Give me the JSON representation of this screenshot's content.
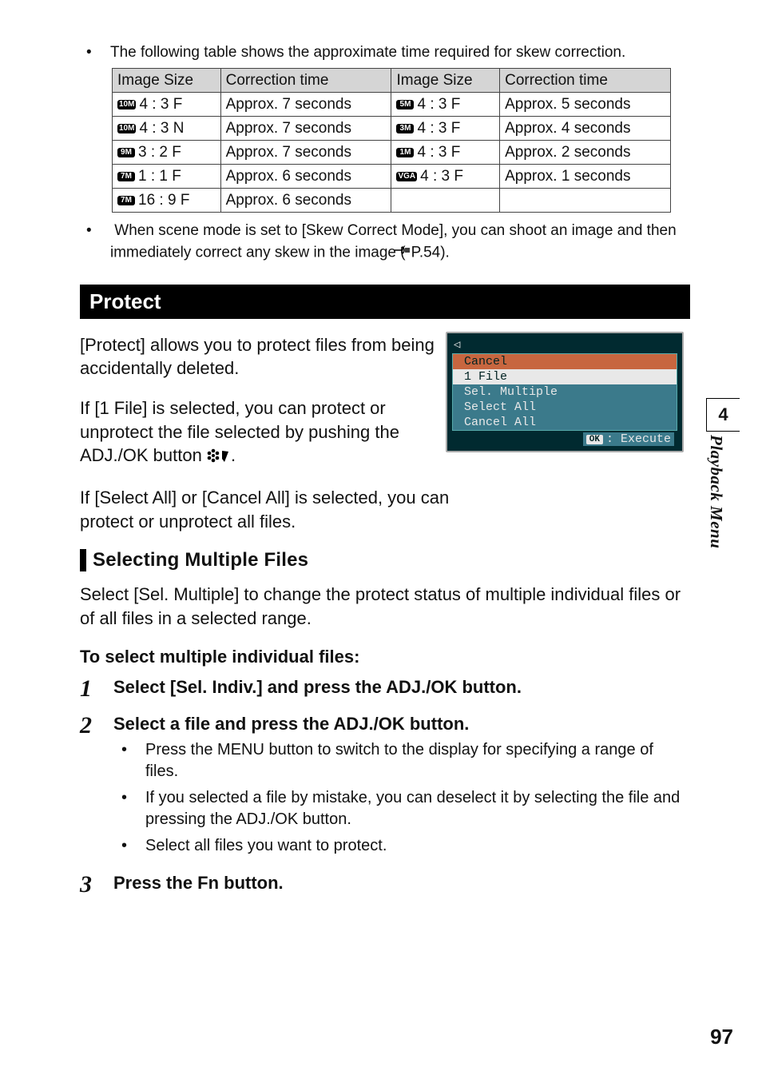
{
  "intro": "The following table shows the approximate time required for skew correction.",
  "table": {
    "headers": [
      "Image Size",
      "Correction time",
      "Image Size",
      "Correction time"
    ],
    "rows": [
      {
        "l_badge": "10M",
        "l_ratio": "4 : 3 F",
        "l_time": "Approx. 7 seconds",
        "r_badge": "5M",
        "r_ratio": "4 : 3 F",
        "r_time": "Approx. 5 seconds"
      },
      {
        "l_badge": "10M",
        "l_ratio": "4 : 3 N",
        "l_time": "Approx. 7 seconds",
        "r_badge": "3M",
        "r_ratio": "4 : 3 F",
        "r_time": "Approx. 4 seconds"
      },
      {
        "l_badge": "9M",
        "l_ratio": "3 : 2 F",
        "l_time": "Approx. 7 seconds",
        "r_badge": "1M",
        "r_ratio": "4 : 3 F",
        "r_time": "Approx. 2 seconds"
      },
      {
        "l_badge": "7M",
        "l_ratio": "1 : 1 F",
        "l_time": "Approx. 6 seconds",
        "r_badge": "VGA",
        "r_ratio": "4 : 3 F",
        "r_time": "Approx. 1 seconds"
      },
      {
        "l_badge": "7M",
        "l_ratio": "16 : 9 F",
        "l_time": "Approx. 6 seconds",
        "r_badge": "",
        "r_ratio": "",
        "r_time": ""
      }
    ]
  },
  "note_after_table_a": "When scene mode is set to [Skew Correct Mode], you can shoot an image and then immediately correct any skew in the image (",
  "note_after_table_b": "P.54).",
  "protect": {
    "title": "Protect",
    "p1": "[Protect] allows you to protect files from being accidentally deleted.",
    "p2a": "If [1 File] is selected, you can protect or unprotect the file selected by pushing the ADJ./OK button ",
    "p2b": ".",
    "p3": "If [Select All] or [Cancel All] is selected, you can protect or unprotect all files."
  },
  "lcd": {
    "items": [
      "Cancel",
      "1 File",
      "Sel. Multiple",
      "Select All",
      "Cancel All"
    ],
    "ok": "OK",
    "execute": ": Execute"
  },
  "multi": {
    "title": "Selecting Multiple Files",
    "intro": "Select [Sel. Multiple] to change the protect status of multiple individual files or of all files in a selected range.",
    "heading": "To select multiple individual files:",
    "steps": [
      {
        "n": "1",
        "title": "Select [Sel. Indiv.] and press the ADJ./OK button.",
        "bullets": []
      },
      {
        "n": "2",
        "title": "Select a file and press the ADJ./OK button.",
        "bullets": [
          "Press the MENU button to switch to the display for specifying a range of files.",
          "If you selected a file by mistake, you can deselect it by selecting the file and pressing the ADJ./OK button.",
          "Select all files you want to protect."
        ]
      },
      {
        "n": "3",
        "title": "Press the Fn button.",
        "bullets": []
      }
    ]
  },
  "side": {
    "num": "4",
    "label": "Playback Menu"
  },
  "page_number": "97"
}
